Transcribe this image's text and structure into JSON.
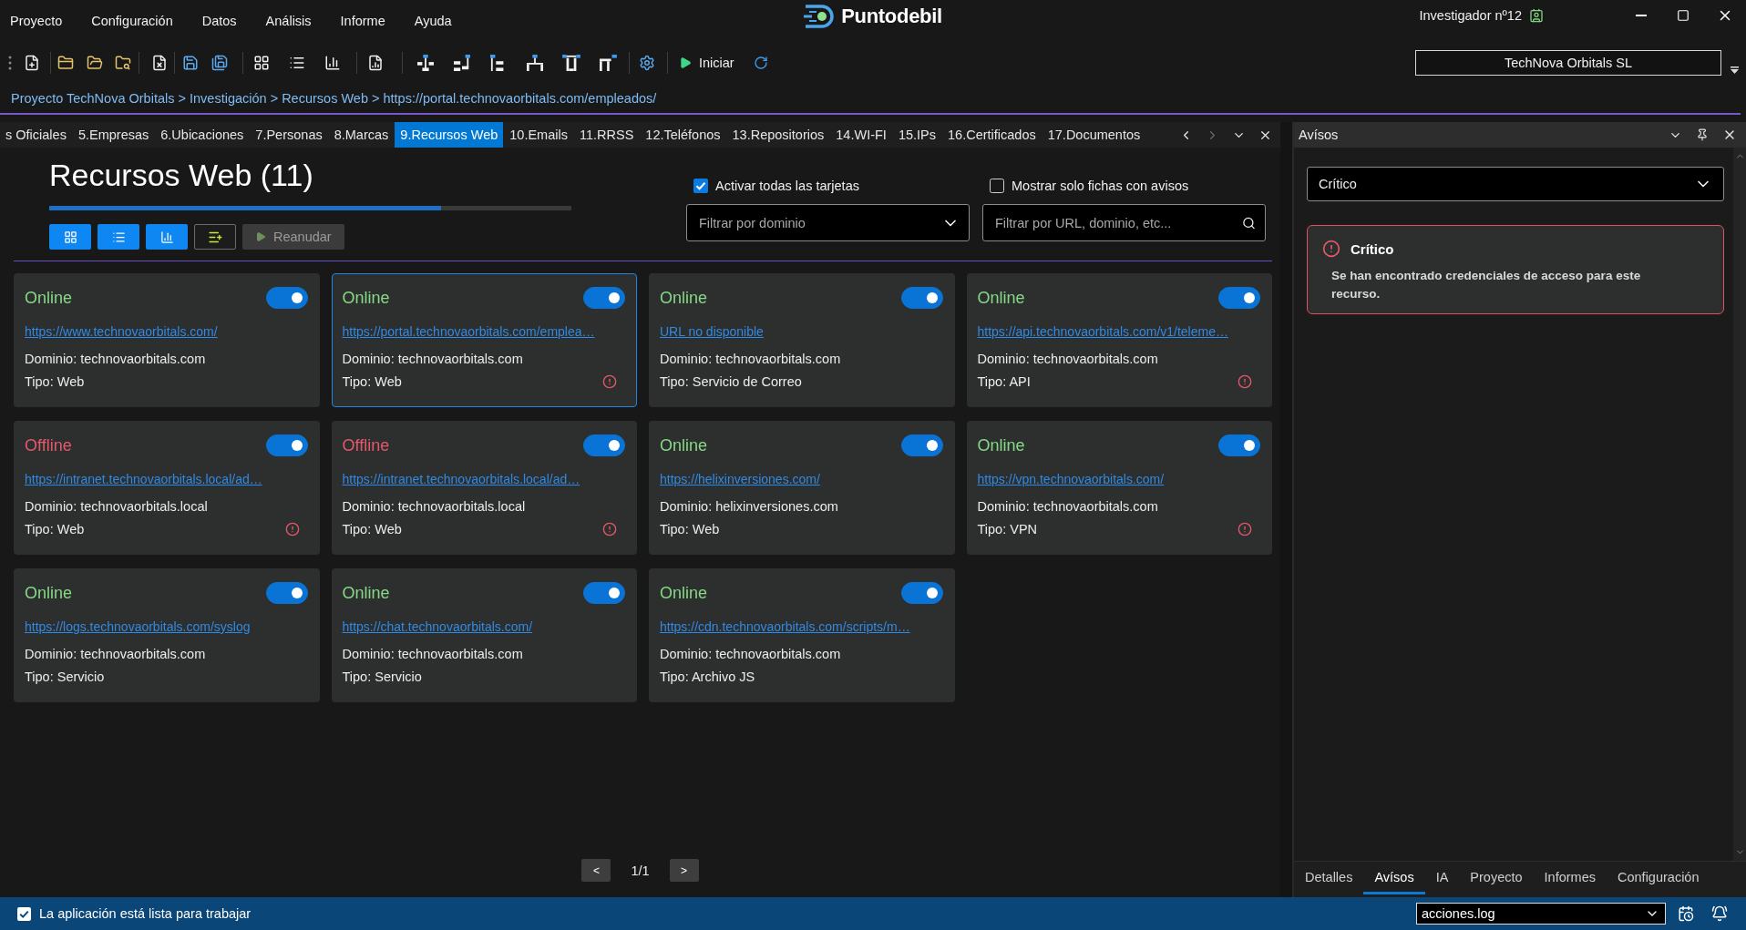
{
  "menu": [
    "Proyecto",
    "Configuración",
    "Datos",
    "Análisis",
    "Informe",
    "Ayuda"
  ],
  "logo": {
    "text": "Puntodebil"
  },
  "user": {
    "name": "Investigador nº12"
  },
  "toolbar": {
    "start_label": "Iniciar"
  },
  "organization": {
    "value": "TechNova Orbitals SL"
  },
  "breadcrumb": "Proyecto TechNova Orbitals > Investigación > Recursos Web > https://portal.technovaorbitals.com/empleados/",
  "tabs": [
    {
      "label": "s Oficiales",
      "selected": false
    },
    {
      "label": "5.Empresas",
      "selected": false
    },
    {
      "label": "6.Ubicaciones",
      "selected": false
    },
    {
      "label": "7.Personas",
      "selected": false
    },
    {
      "label": "8.Marcas",
      "selected": false
    },
    {
      "label": "9.Recursos Web",
      "selected": true
    },
    {
      "label": "10.Emails",
      "selected": false
    },
    {
      "label": "11.RRSS",
      "selected": false
    },
    {
      "label": "12.Teléfonos",
      "selected": false
    },
    {
      "label": "13.Repositorios",
      "selected": false
    },
    {
      "label": "14.WI-FI",
      "selected": false
    },
    {
      "label": "15.IPs",
      "selected": false
    },
    {
      "label": "16.Certificados",
      "selected": false
    },
    {
      "label": "17.Documentos",
      "selected": false
    }
  ],
  "tab_nav": {
    "prev_disabled": false,
    "next_disabled": true
  },
  "resources": {
    "title": "Recursos Web (11)",
    "progress": {
      "level": 0.75
    },
    "resume_button": {
      "label": "Reanudar",
      "disabled": true
    },
    "activate_all": {
      "label": "Activar todas las tarjetas",
      "checked": true
    },
    "only_alerts": {
      "label": "Mostrar solo fichas con avisos",
      "checked": false
    },
    "domain_filter": {
      "placeholder": "Filtrar por dominio"
    },
    "search": {
      "placeholder": "Filtrar por URL, dominio, etc..."
    },
    "cards": [
      {
        "status": "Online",
        "online": true,
        "url": "https://www.technovaorbitals.com/",
        "domain": "Dominio: technovaorbitals.com",
        "type": "Tipo: Web",
        "enabled": true,
        "alert": false,
        "selected": false
      },
      {
        "status": "Online",
        "online": true,
        "url": "https://portal.technovaorbitals.com/emplea…",
        "domain": "Dominio: technovaorbitals.com",
        "type": "Tipo: Web",
        "enabled": true,
        "alert": true,
        "selected": true
      },
      {
        "status": "Online",
        "online": true,
        "url": "URL no disponible",
        "domain": "Dominio: technovaorbitals.com",
        "type": "Tipo: Servicio de Correo",
        "enabled": true,
        "alert": false,
        "selected": false
      },
      {
        "status": "Online",
        "online": true,
        "url": "https://api.technovaorbitals.com/v1/teleme…",
        "domain": "Dominio: technovaorbitals.com",
        "type": "Tipo: API",
        "enabled": true,
        "alert": true,
        "selected": false
      },
      {
        "status": "Offline",
        "online": false,
        "url": "https://intranet.technovaorbitals.local/ad…",
        "domain": "Dominio: technovaorbitals.local",
        "type": "Tipo: Web",
        "enabled": true,
        "alert": true,
        "selected": false
      },
      {
        "status": "Offline",
        "online": false,
        "url": "https://intranet.technovaorbitals.local/ad…",
        "domain": "Dominio: technovaorbitals.local",
        "type": "Tipo: Web",
        "enabled": true,
        "alert": true,
        "selected": false
      },
      {
        "status": "Online",
        "online": true,
        "url": "https://helixinversiones.com/",
        "domain": "Dominio: helixinversiones.com",
        "type": "Tipo: Web",
        "enabled": true,
        "alert": false,
        "selected": false
      },
      {
        "status": "Online",
        "online": true,
        "url": "https://vpn.technovaorbitals.com/",
        "domain": "Dominio: technovaorbitals.com",
        "type": "Tipo: VPN",
        "enabled": true,
        "alert": true,
        "selected": false
      },
      {
        "status": "Online",
        "online": true,
        "url": "https://logs.technovaorbitals.com/syslog",
        "domain": "Dominio: technovaorbitals.com",
        "type": "Tipo: Servicio",
        "enabled": true,
        "alert": false,
        "selected": false
      },
      {
        "status": "Online",
        "online": true,
        "url": "https://chat.technovaorbitals.com/",
        "domain": "Dominio: technovaorbitals.com",
        "type": "Tipo: Servicio",
        "enabled": true,
        "alert": false,
        "selected": false
      },
      {
        "status": "Online",
        "online": true,
        "url": "https://cdn.technovaorbitals.com/scripts/m…",
        "domain": "Dominio: technovaorbitals.com",
        "type": "Tipo: Archivo JS",
        "enabled": true,
        "alert": false,
        "selected": false
      }
    ],
    "pagination": {
      "prev": "<",
      "page": "1/1",
      "next": ">"
    }
  },
  "alerts_panel": {
    "title": "Avísos",
    "severity_filter": {
      "value": "Crítico"
    },
    "alerts": [
      {
        "title": "Crítico",
        "message": "Se han encontrado credenciales de acceso para este recurso."
      }
    ],
    "tabs": [
      {
        "label": "Detalles",
        "selected": false
      },
      {
        "label": "Avísos",
        "selected": true
      },
      {
        "label": "IA",
        "selected": false
      },
      {
        "label": "Proyecto",
        "selected": false
      },
      {
        "label": "Informes",
        "selected": false
      },
      {
        "label": "Configuración",
        "selected": false
      }
    ]
  },
  "status_bar": {
    "message": "La aplicación está lista para trabajar",
    "log_file": {
      "value": "acciones.log"
    }
  }
}
